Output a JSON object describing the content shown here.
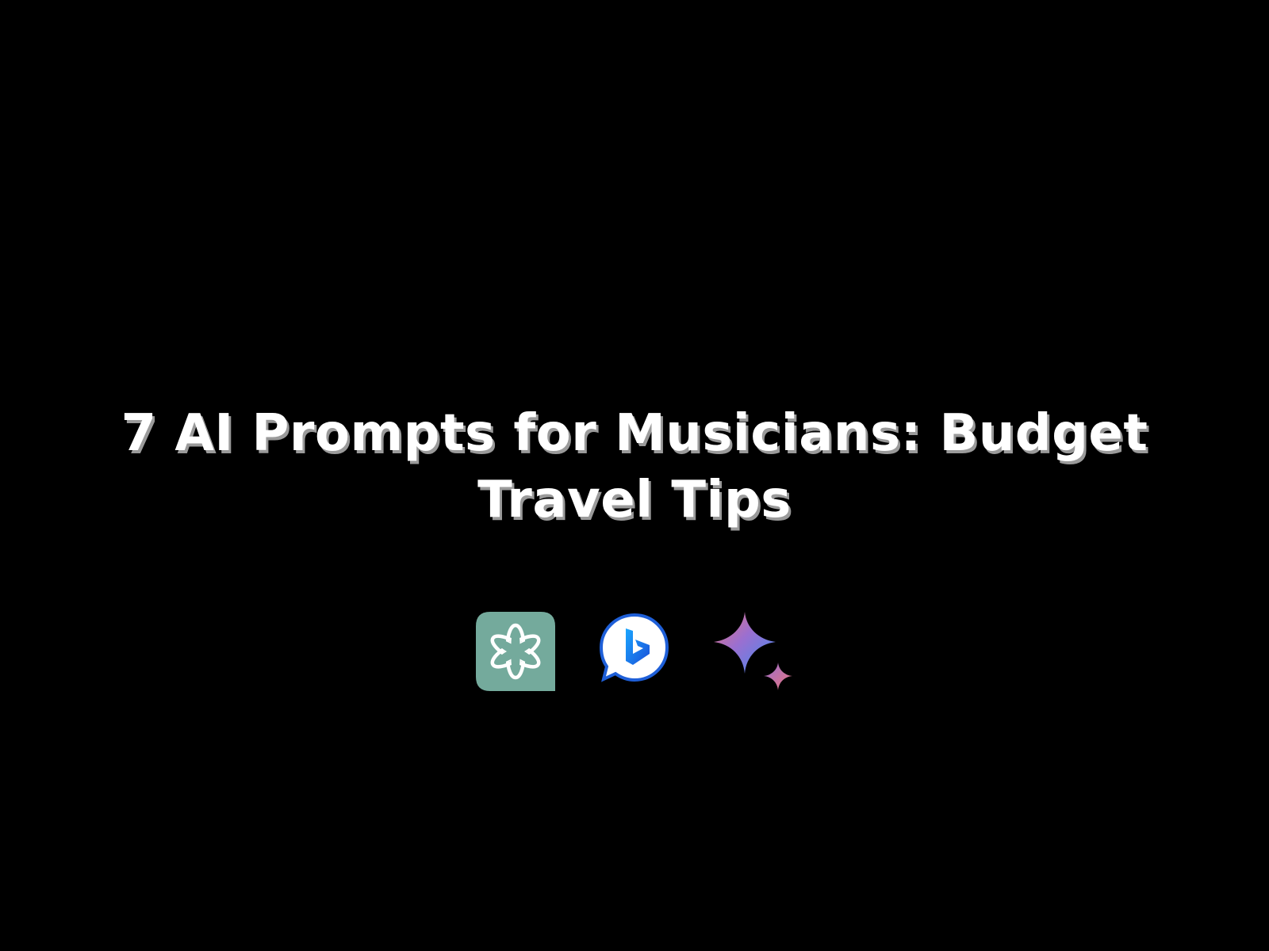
{
  "title": {
    "line1": "7 AI Prompts for Musicians: Budget",
    "line2": "Travel Tips"
  },
  "icons": [
    {
      "name": "chatgpt-logo-icon",
      "color": "#74aa9c"
    },
    {
      "name": "bing-chat-logo-icon",
      "color": "#1e5fd8"
    },
    {
      "name": "gemini-sparkle-logo-icon",
      "colors": [
        "#4a8ff0",
        "#9b6fd0",
        "#e8747c"
      ]
    }
  ],
  "colors": {
    "background": "#000000",
    "text": "#ffffff",
    "text_shadow": "#9a9a9a"
  }
}
